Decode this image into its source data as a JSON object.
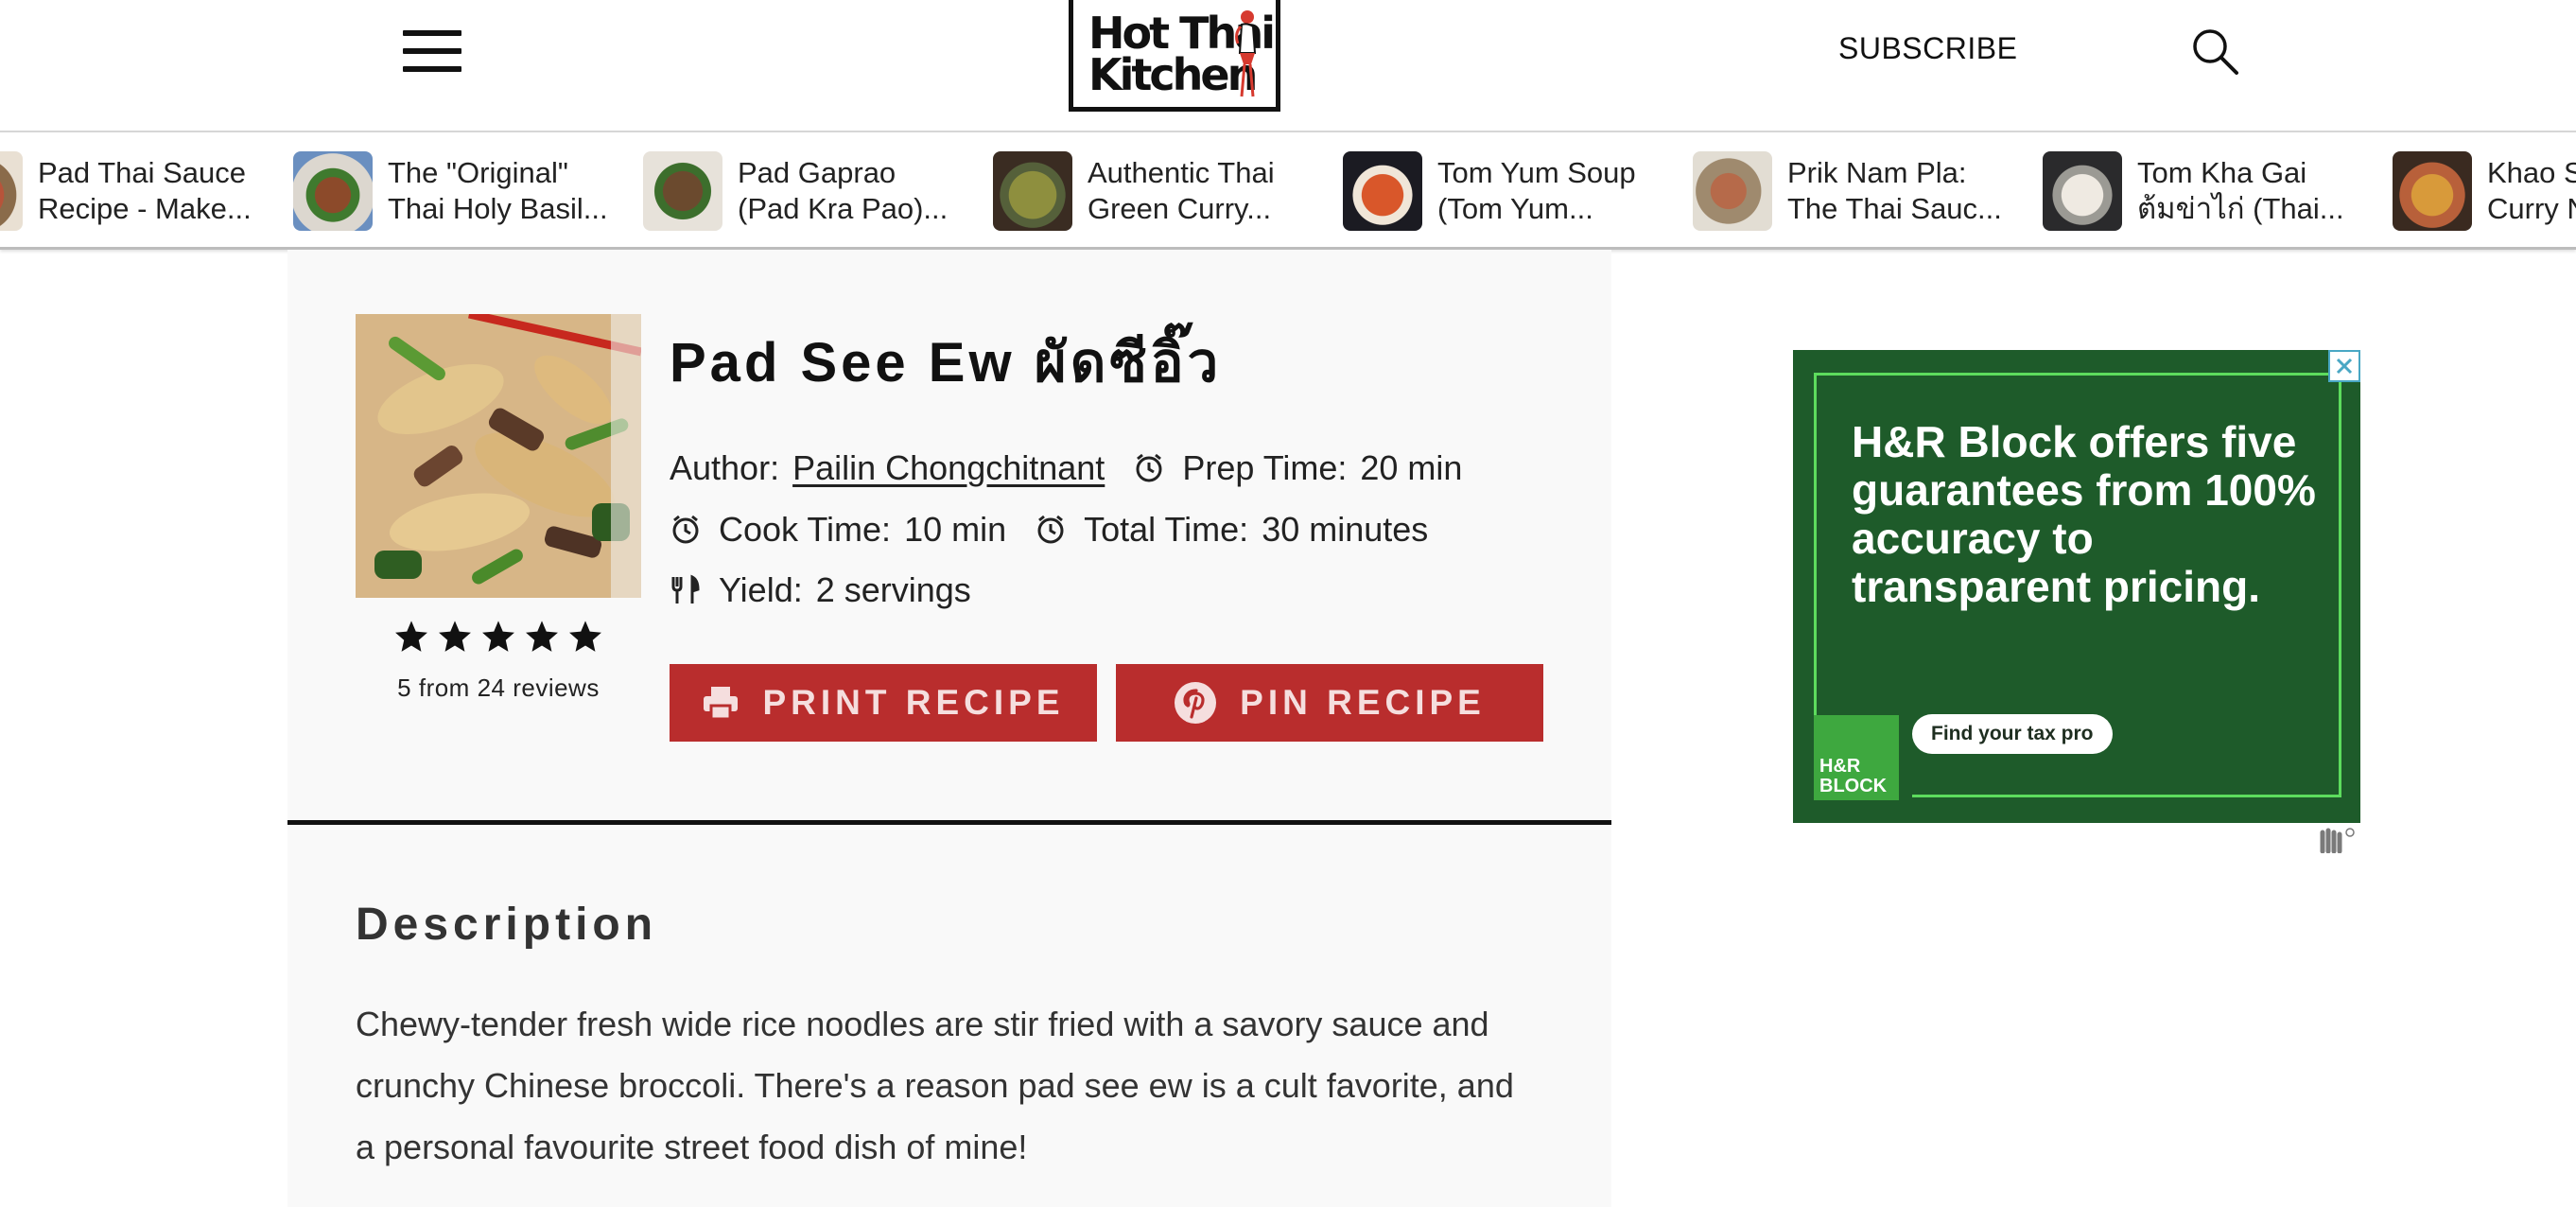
{
  "header": {
    "logo_text_line1": "Hot Thai",
    "logo_text_line2": "Kitchen",
    "subscribe_label": "SUBSCRIBE"
  },
  "carousel": {
    "items": [
      {
        "line1": "Pad Thai Sauce",
        "line2": "Recipe - Make..."
      },
      {
        "line1": "The \"Original\"",
        "line2": "Thai Holy Basil..."
      },
      {
        "line1": "Pad Gaprao",
        "line2": "(Pad Kra Pao)..."
      },
      {
        "line1": "Authentic Thai",
        "line2": "Green Curry..."
      },
      {
        "line1": "Tom Yum Soup",
        "line2": "(Tom Yum..."
      },
      {
        "line1": "Prik Nam Pla:",
        "line2": "The Thai Sauc..."
      },
      {
        "line1": "Tom Kha Gai",
        "line2": "ต้มข่าไก่ (Thai..."
      },
      {
        "line1": "Khao S",
        "line2": "Curry N"
      }
    ]
  },
  "recipe": {
    "title": "Pad See Ew ผัดซีอิ๊ว",
    "rating_stars": 5,
    "reviews_text": "5 from 24 reviews",
    "author_label": "Author:",
    "author_name": "Pailin Chongchitnant",
    "prep_label": "Prep Time:",
    "prep_value": "20 min",
    "cook_label": "Cook Time:",
    "cook_value": "10 min",
    "total_label": "Total Time:",
    "total_value": "30 minutes",
    "yield_label": "Yield:",
    "yield_value": "2 servings",
    "print_label": "PRINT RECIPE",
    "pin_label": "PIN RECIPE",
    "description_heading": "Description",
    "description_text": "Chewy-tender fresh wide rice noodles are stir fried with a savory sauce and crunchy Chinese broccoli. There's a reason pad see ew is a cult favorite, and a personal favourite street food dish of mine!"
  },
  "ad": {
    "headline": "H&R Block offers five guarantees from 100% accuracy to transparent pricing.",
    "cta": "Find your tax pro",
    "logo_line1": "H&R",
    "logo_line2": "BLOCK"
  },
  "colors": {
    "button_red": "#b92d2d",
    "ad_green": "#1e5b2a",
    "ad_accent": "#5ddc5d",
    "card_bg": "#f9f9f9"
  }
}
